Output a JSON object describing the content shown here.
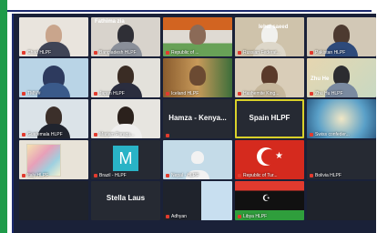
{
  "tiles": [
    {
      "label": "Chad HLPF",
      "top_name": ""
    },
    {
      "label": "Bangladesh HLPF",
      "top_name": "Fathima zia"
    },
    {
      "label": "Republic of ...",
      "top_name": ""
    },
    {
      "label": "Russian Federat...",
      "top_name": "Iehal saeed"
    },
    {
      "label": "Pakistan HLPF",
      "top_name": ""
    },
    {
      "label": "TMN'#",
      "top_name": ""
    },
    {
      "label": "Japan HLPF",
      "top_name": ""
    },
    {
      "label": "Iceland HLPF",
      "top_name": ""
    },
    {
      "label": "Hashemite King...",
      "top_name": ""
    },
    {
      "label": "Zhu Hu HLPF",
      "top_name": "Zhu He"
    },
    {
      "label": "Guatemala HLPF",
      "top_name": ""
    },
    {
      "label": "Mariam Paraqu...",
      "top_name": ""
    },
    {
      "label": "",
      "big_name": "Hamza - Kenya..."
    },
    {
      "label": "",
      "big_name": "Spain HLPF"
    },
    {
      "label": "Swiss confeder...",
      "top_name": ""
    },
    {
      "label": "Italy HLPF",
      "top_name": ""
    },
    {
      "label": "Brazil - HLPF",
      "top_name": "",
      "letter": "M"
    },
    {
      "label": "Nepal - HLPF",
      "top_name": ""
    },
    {
      "label": "Republic of Tur...",
      "top_name": ""
    },
    {
      "label": "Bolivia HLPF",
      "top_name": ""
    },
    {
      "label": "",
      "big_name": "Stella Laus"
    },
    {
      "label": "Adhyan",
      "top_name": ""
    },
    {
      "label": "Libya HLPF",
      "top_name": ""
    }
  ],
  "colors": {
    "accent": "#1f9b4a",
    "active_speaker": "#d9d12a",
    "muted": "#e23b2e"
  },
  "icons": {
    "muted_mic": "mic-muted-icon"
  }
}
